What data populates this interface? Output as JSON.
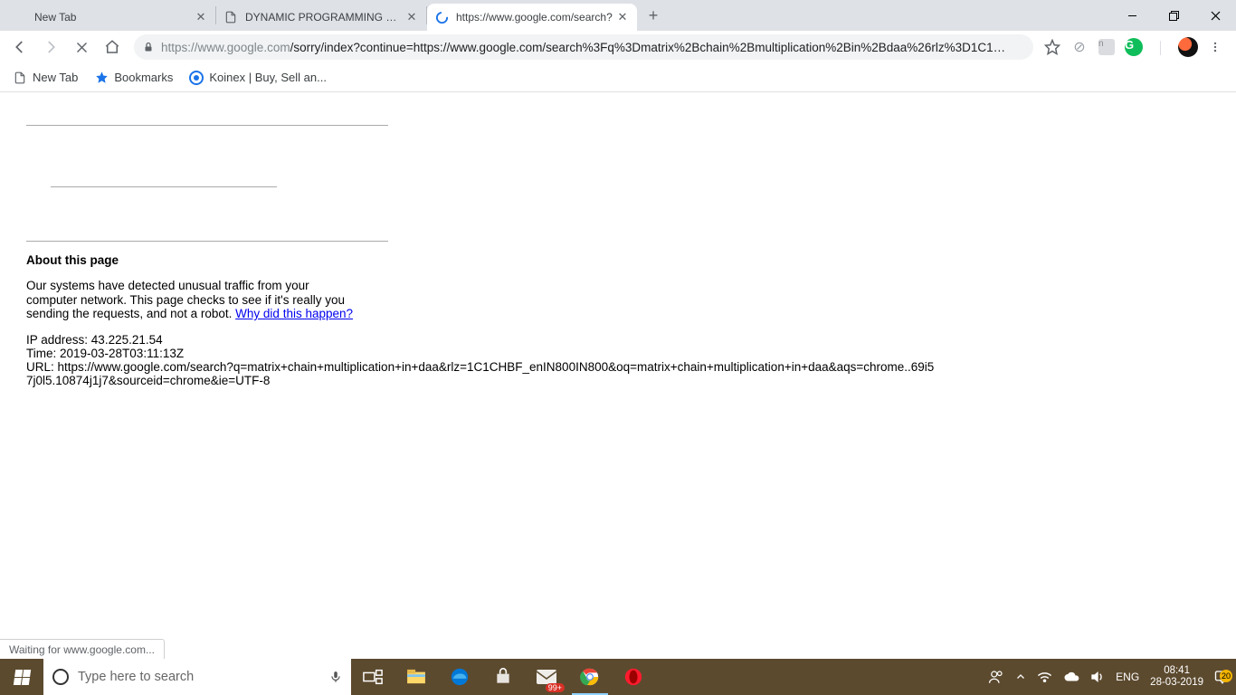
{
  "tabs": [
    {
      "title": "New Tab",
      "icon": "blank"
    },
    {
      "title": "DYNAMIC PROGRAMMING UNIT",
      "icon": "file"
    },
    {
      "title": "https://www.google.com/search?",
      "icon": "loading"
    }
  ],
  "window": {
    "minimize": "—",
    "maximize": "❐",
    "close": "✕"
  },
  "toolbar": {
    "url_dim_prefix": "https://www.google.com",
    "url_rest": "/sorry/index?continue=https://www.google.com/search%3Fq%3Dmatrix%2Bchain%2Bmultiplication%2Bin%2Bdaa%26rlz%3D1C1…"
  },
  "bookmarks": [
    {
      "label": "New Tab",
      "icon": "file"
    },
    {
      "label": "Bookmarks",
      "icon": "star"
    },
    {
      "label": "Koinex | Buy, Sell an...",
      "icon": "koin"
    }
  ],
  "page": {
    "about_heading": "About this page",
    "about_text_1": "Our systems have detected unusual traffic from your computer network. This page checks to see if it's really you sending the requests, and not a robot. ",
    "about_link": "Why did this happen?",
    "ip_label": "IP address: ",
    "ip_value": "43.225.21.54",
    "time_label": "Time: ",
    "time_value": "2019-03-28T03:11:13Z",
    "url_label": "URL: ",
    "url_value": "https://www.google.com/search?q=matrix+chain+multiplication+in+daa&rlz=1C1CHBF_enIN800IN800&oq=matrix+chain+multiplication+in+daa&aqs=chrome..69i57j0l5.10874j1j7&sourceid=chrome&ie=UTF-8",
    "status_text": "Waiting for www.google.com..."
  },
  "taskbar": {
    "search_placeholder": "Type here to search",
    "lang": "ENG",
    "time": "08:41",
    "date": "28-03-2019",
    "mail_badge": "99+",
    "action_badge": "20"
  }
}
